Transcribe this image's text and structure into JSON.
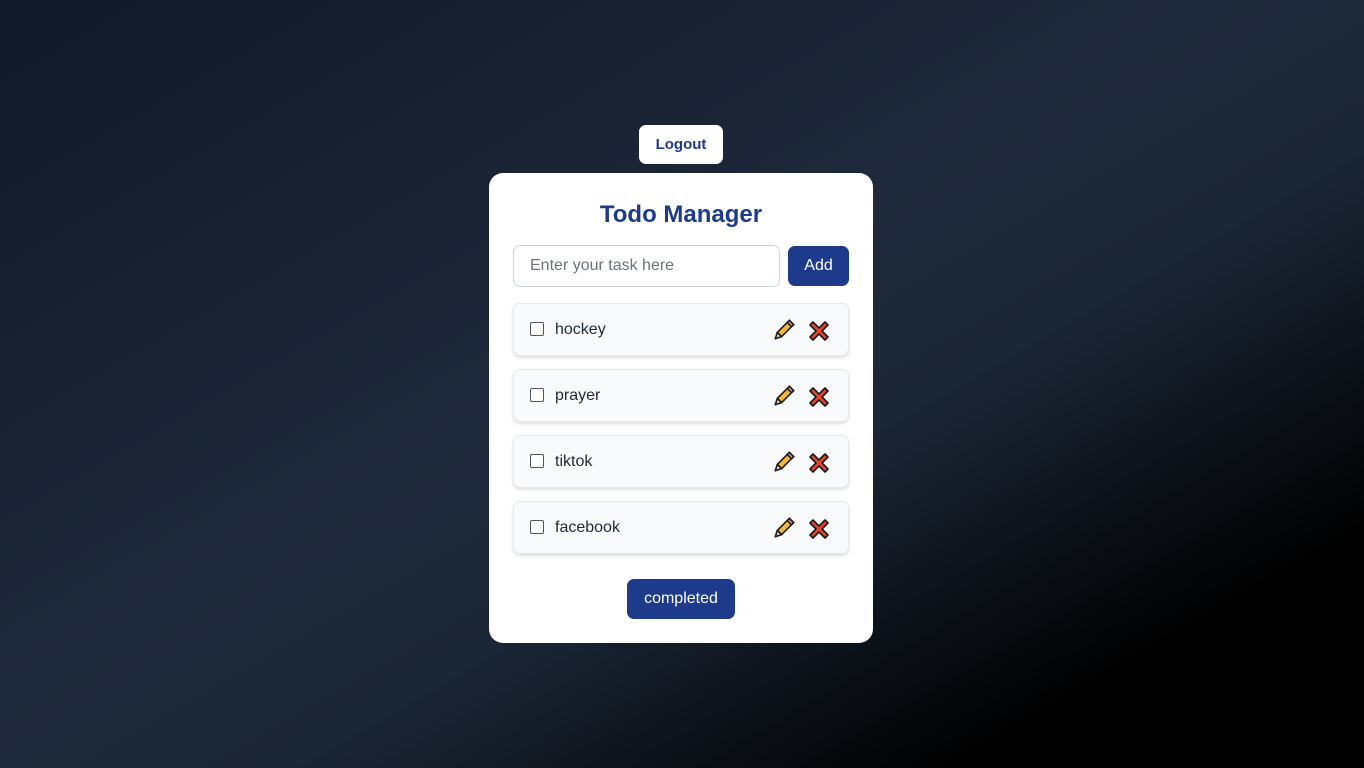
{
  "header": {
    "logout_label": "Logout"
  },
  "card": {
    "title": "Todo Manager",
    "input": {
      "value": "",
      "placeholder": "Enter your task here"
    },
    "add_label": "Add",
    "todos": [
      {
        "text": "hockey",
        "checked": false,
        "edit_icon": "pencil-icon",
        "delete_icon": "cross-mark-icon"
      },
      {
        "text": "prayer",
        "checked": false,
        "edit_icon": "pencil-icon",
        "delete_icon": "cross-mark-icon"
      },
      {
        "text": "tiktok",
        "checked": false,
        "edit_icon": "pencil-icon",
        "delete_icon": "cross-mark-icon"
      },
      {
        "text": "facebook",
        "checked": false,
        "edit_icon": "pencil-icon",
        "delete_icon": "cross-mark-icon"
      }
    ],
    "completed_label": "completed"
  },
  "colors": {
    "accent": "#1e3a8a",
    "card_background": "#ffffff",
    "item_background": "#f8fafc",
    "pencil_body": "#f5b82e",
    "cross_fill": "#e5452c"
  }
}
